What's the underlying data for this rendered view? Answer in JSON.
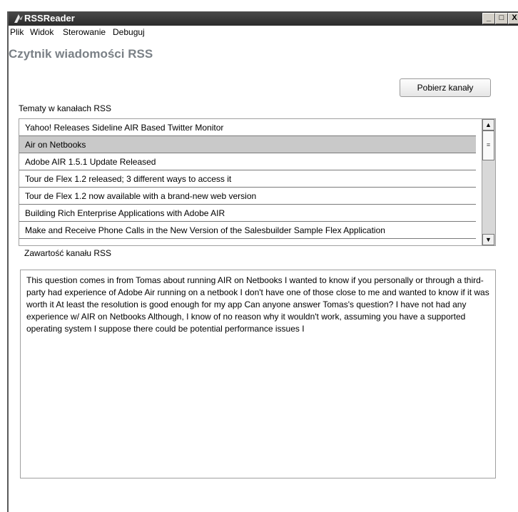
{
  "window": {
    "title": "RSSReader",
    "controls": {
      "minimize": "_",
      "maximize": "□",
      "close": "X"
    }
  },
  "menu": [
    "Plik",
    "Widok",
    "Sterowanie",
    "Debuguj"
  ],
  "app_title": "Czytnik wiadomości  RSS",
  "topics_label": "Tematy w kanałach RSS",
  "fetch_button": "Pobierz kanały",
  "topics": [
    "Yahoo! Releases Sideline AIR Based Twitter Monitor",
    "Air on Netbooks",
    "Adobe AIR 1.5.1 Update Released",
    "Tour de Flex 1.2 released; 3 different ways to access it",
    "Tour de Flex 1.2 now available with a brand-new web version",
    "Building Rich Enterprise Applications with Adobe AIR",
    "Make and Receive Phone Calls in the New Version of the Salesbuilder Sample Flex Application"
  ],
  "selected_topic": "Air on Netbooks",
  "content_label": "Zawartość kanału RSS",
  "content_text": "This question comes in from Tomas about running AIR on Netbooks I wanted to know if you personally or through a third-party had experience of Adobe Air running on a netbook I don't have one of those close to me and wanted to know if it was worth it At least the resolution is good enough for my app Can anyone answer Tomas's question? I have not had any experience w/ AIR on Netbooks Although, I know of no reason why it wouldn't work, assuming you have a supported operating system I suppose there could be potential performance issues I"
}
